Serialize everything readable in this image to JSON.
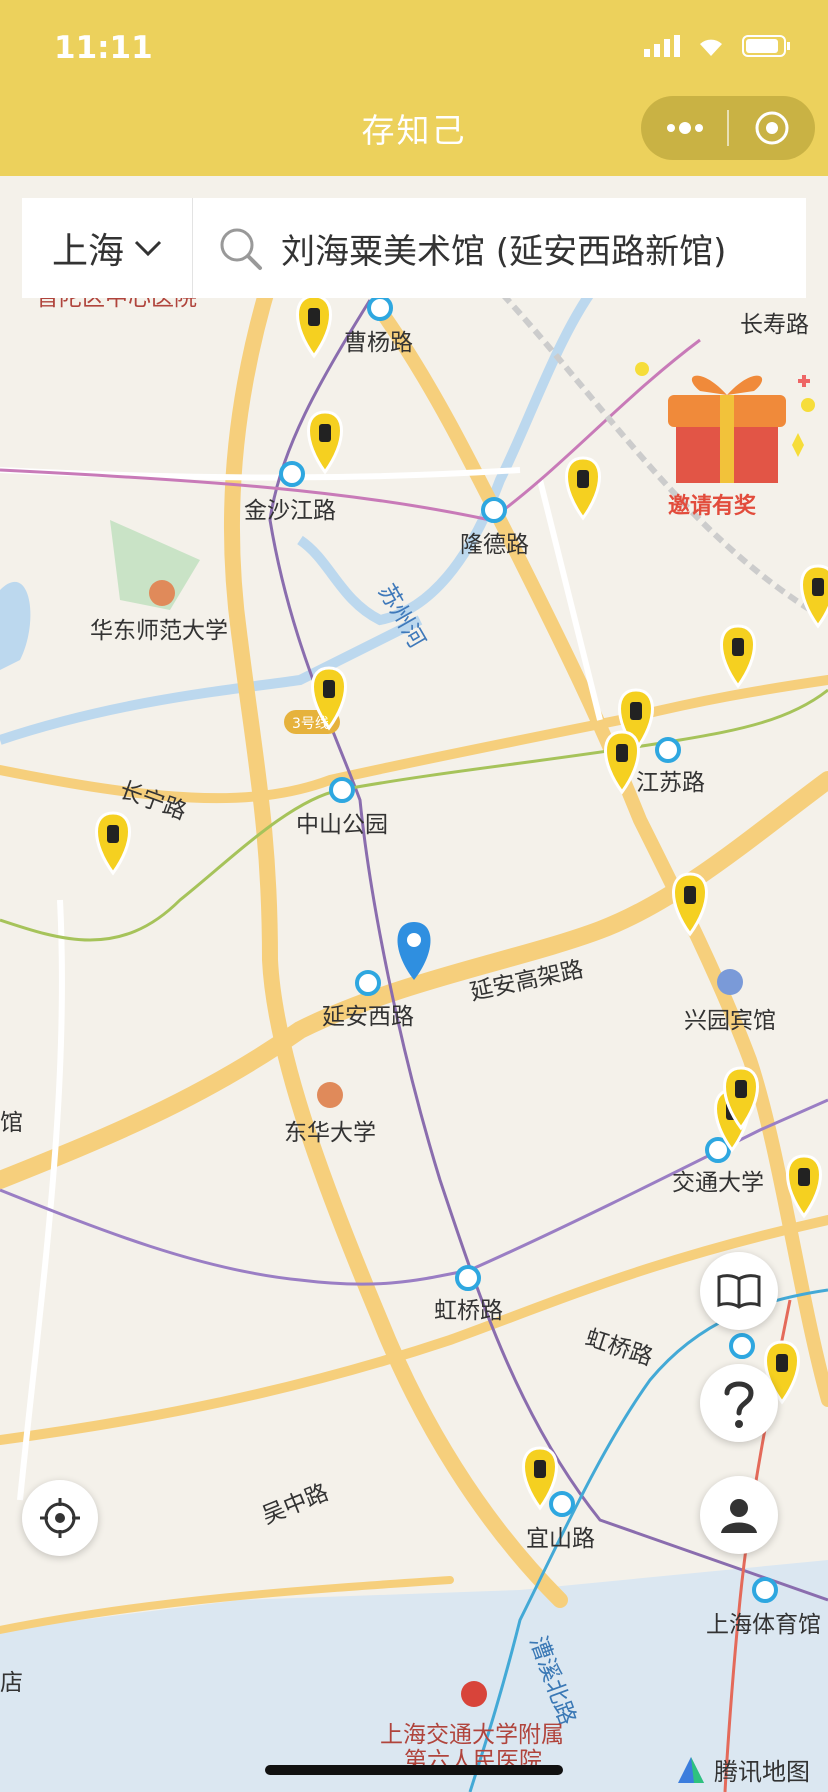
{
  "status_bar": {
    "time": "11:11"
  },
  "header": {
    "title": "存知己"
  },
  "search": {
    "city": "上海",
    "query": "刘海粟美术馆 (延安西路新馆)"
  },
  "promo": {
    "label": "邀请有奖"
  },
  "map": {
    "labels": {
      "hospital_top": "普陀区中心医院",
      "caoyang": "曹杨路",
      "changshou": "长寿路",
      "jinshajiang": "金沙江路",
      "longde": "隆德路",
      "suzhouhe": "苏州河",
      "ecnu": "华东师范大学",
      "line3": "3号线",
      "changning": "长宁路",
      "zhongshan_park": "中山公园",
      "jiangsu": "江苏路",
      "yanan_elevated": "延安高架路",
      "yanan_west": "延安西路",
      "xingyuan": "兴园宾馆",
      "donghua": "东华大学",
      "jiaotong": "交通大学",
      "hongqiao": "虹桥路",
      "hongqiao_road": "虹桥路",
      "wuzhong": "吴中路",
      "yishan": "宜山路",
      "stadium": "上海体育馆",
      "caoxi": "漕溪北路",
      "sixth_hospital_1": "上海交通大学附属",
      "sixth_hospital_2": "第六人民医院",
      "left_edge_1": "馆",
      "left_edge_2": "店"
    }
  },
  "attribution": {
    "brand": "腾讯地图"
  },
  "colors": {
    "header": "#ecd15c",
    "pin": "#f5d020",
    "location": "#2f8fe0"
  }
}
